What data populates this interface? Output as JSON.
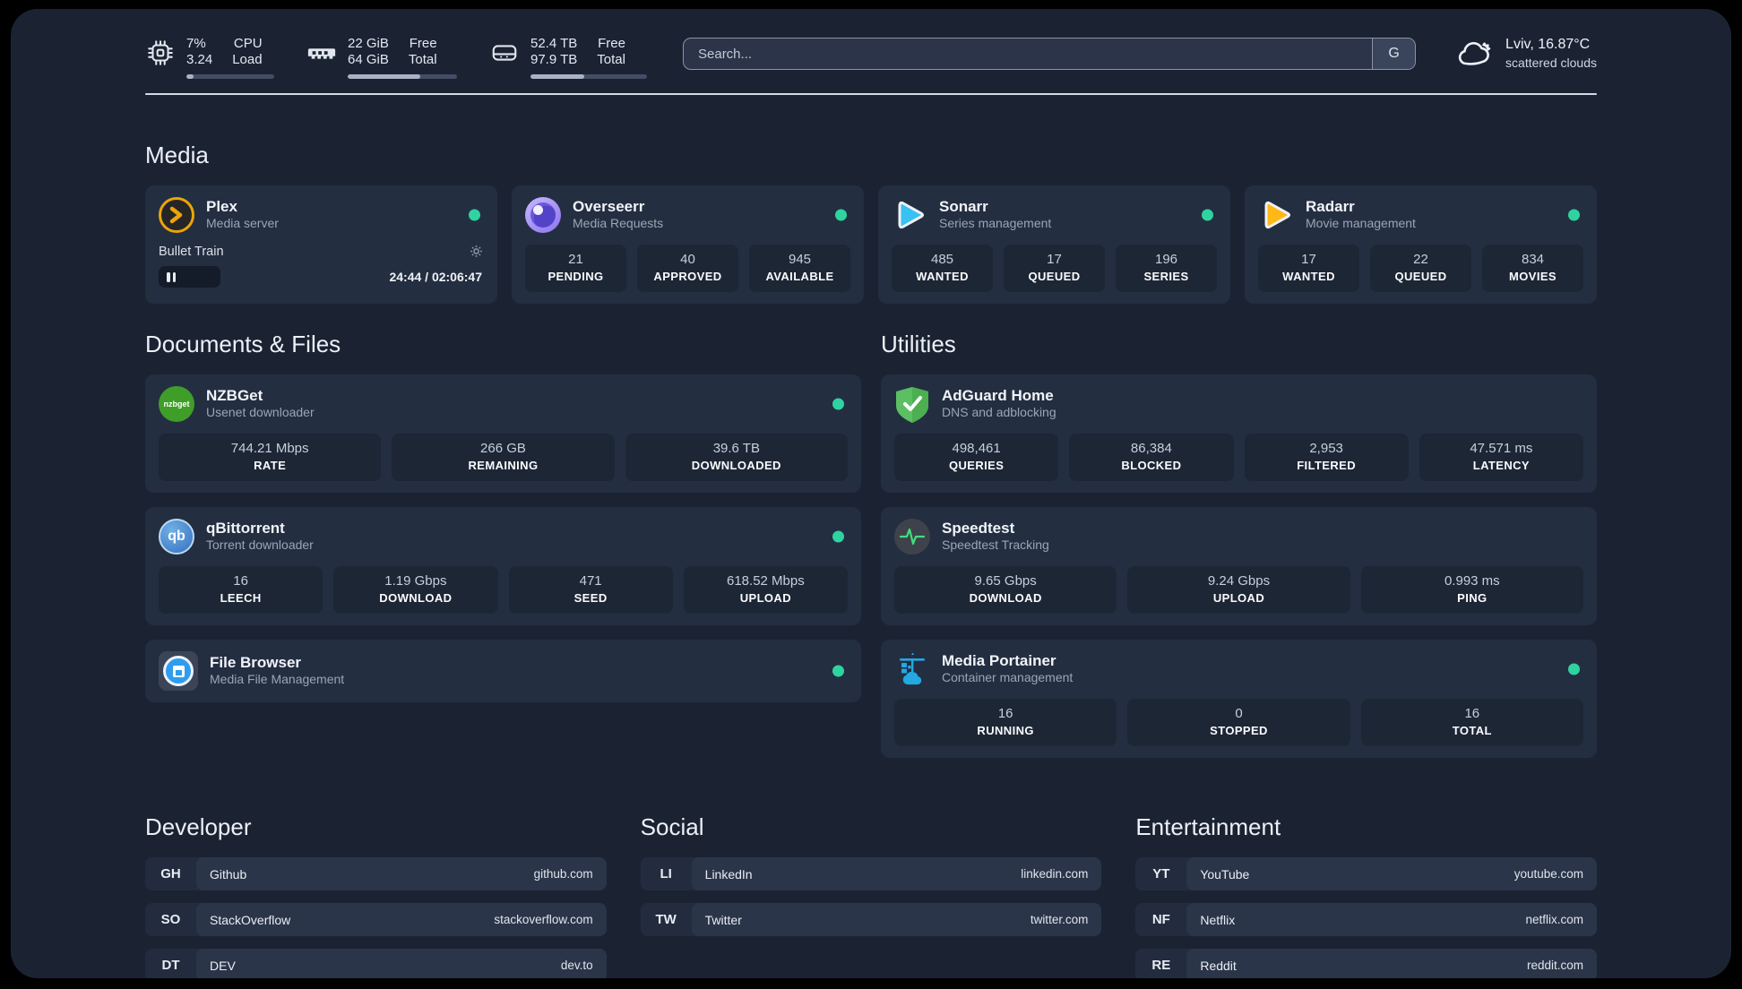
{
  "header": {
    "cpu": {
      "value1": "7%",
      "value2": "3.24",
      "label1": "CPU",
      "label2": "Load",
      "progress_pct": 8
    },
    "ram": {
      "value1": "22 GiB",
      "value2": "64 GiB",
      "label1": "Free",
      "label2": "Total",
      "progress_pct": 66
    },
    "disk": {
      "value1": "52.4 TB",
      "value2": "97.9 TB",
      "label1": "Free",
      "label2": "Total",
      "progress_pct": 46
    },
    "search": {
      "placeholder": "Search...",
      "engine_button": "G"
    },
    "weather": {
      "location": "Lviv, 16.87°C",
      "condition": "scattered clouds"
    }
  },
  "sections": {
    "media": {
      "title": "Media",
      "plex": {
        "name": "Plex",
        "desc": "Media server",
        "player": {
          "title": "Bullet Train",
          "time_display": "24:44 / 02:06:47",
          "progress_pct": 19
        }
      },
      "overseerr": {
        "name": "Overseerr",
        "desc": "Media Requests",
        "stats": [
          {
            "value": "21",
            "label": "PENDING"
          },
          {
            "value": "40",
            "label": "APPROVED"
          },
          {
            "value": "945",
            "label": "AVAILABLE"
          }
        ]
      },
      "sonarr": {
        "name": "Sonarr",
        "desc": "Series management",
        "stats": [
          {
            "value": "485",
            "label": "WANTED"
          },
          {
            "value": "17",
            "label": "QUEUED"
          },
          {
            "value": "196",
            "label": "SERIES"
          }
        ]
      },
      "radarr": {
        "name": "Radarr",
        "desc": "Movie management",
        "stats": [
          {
            "value": "17",
            "label": "WANTED"
          },
          {
            "value": "22",
            "label": "QUEUED"
          },
          {
            "value": "834",
            "label": "MOVIES"
          }
        ]
      }
    },
    "documents": {
      "title": "Documents & Files",
      "nzbget": {
        "name": "NZBGet",
        "desc": "Usenet downloader",
        "icon_text": "nzbget",
        "stats": [
          {
            "value": "744.21 Mbps",
            "label": "RATE"
          },
          {
            "value": "266 GB",
            "label": "REMAINING"
          },
          {
            "value": "39.6 TB",
            "label": "DOWNLOADED"
          }
        ]
      },
      "qbittorrent": {
        "name": "qBittorrent",
        "desc": "Torrent downloader",
        "icon_text": "qb",
        "stats": [
          {
            "value": "16",
            "label": "LEECH"
          },
          {
            "value": "1.19 Gbps",
            "label": "DOWNLOAD"
          },
          {
            "value": "471",
            "label": "SEED"
          },
          {
            "value": "618.52 Mbps",
            "label": "UPLOAD"
          }
        ]
      },
      "filebrowser": {
        "name": "File Browser",
        "desc": "Media File Management"
      }
    },
    "utilities": {
      "title": "Utilities",
      "adguard": {
        "name": "AdGuard Home",
        "desc": "DNS and adblocking",
        "stats": [
          {
            "value": "498,461",
            "label": "QUERIES"
          },
          {
            "value": "86,384",
            "label": "BLOCKED"
          },
          {
            "value": "2,953",
            "label": "FILTERED"
          },
          {
            "value": "47.571 ms",
            "label": "LATENCY"
          }
        ]
      },
      "speedtest": {
        "name": "Speedtest",
        "desc": "Speedtest Tracking",
        "stats": [
          {
            "value": "9.65 Gbps",
            "label": "DOWNLOAD"
          },
          {
            "value": "9.24 Gbps",
            "label": "UPLOAD"
          },
          {
            "value": "0.993 ms",
            "label": "PING"
          }
        ]
      },
      "portainer": {
        "name": "Media Portainer",
        "desc": "Container management",
        "stats": [
          {
            "value": "16",
            "label": "RUNNING"
          },
          {
            "value": "0",
            "label": "STOPPED"
          },
          {
            "value": "16",
            "label": "TOTAL"
          }
        ]
      }
    },
    "developer": {
      "title": "Developer",
      "bookmarks": [
        {
          "abbr": "GH",
          "name": "Github",
          "url": "github.com"
        },
        {
          "abbr": "SO",
          "name": "StackOverflow",
          "url": "stackoverflow.com"
        },
        {
          "abbr": "DT",
          "name": "DEV",
          "url": "dev.to"
        }
      ]
    },
    "social": {
      "title": "Social",
      "bookmarks": [
        {
          "abbr": "LI",
          "name": "LinkedIn",
          "url": "linkedin.com"
        },
        {
          "abbr": "TW",
          "name": "Twitter",
          "url": "twitter.com"
        }
      ]
    },
    "entertainment": {
      "title": "Entertainment",
      "bookmarks": [
        {
          "abbr": "YT",
          "name": "YouTube",
          "url": "youtube.com"
        },
        {
          "abbr": "NF",
          "name": "Netflix",
          "url": "netflix.com"
        },
        {
          "abbr": "RE",
          "name": "Reddit",
          "url": "reddit.com"
        }
      ]
    }
  },
  "colors": {
    "status_online": "#2fd3a0",
    "background": "#1b2333",
    "card": "#242e41"
  }
}
